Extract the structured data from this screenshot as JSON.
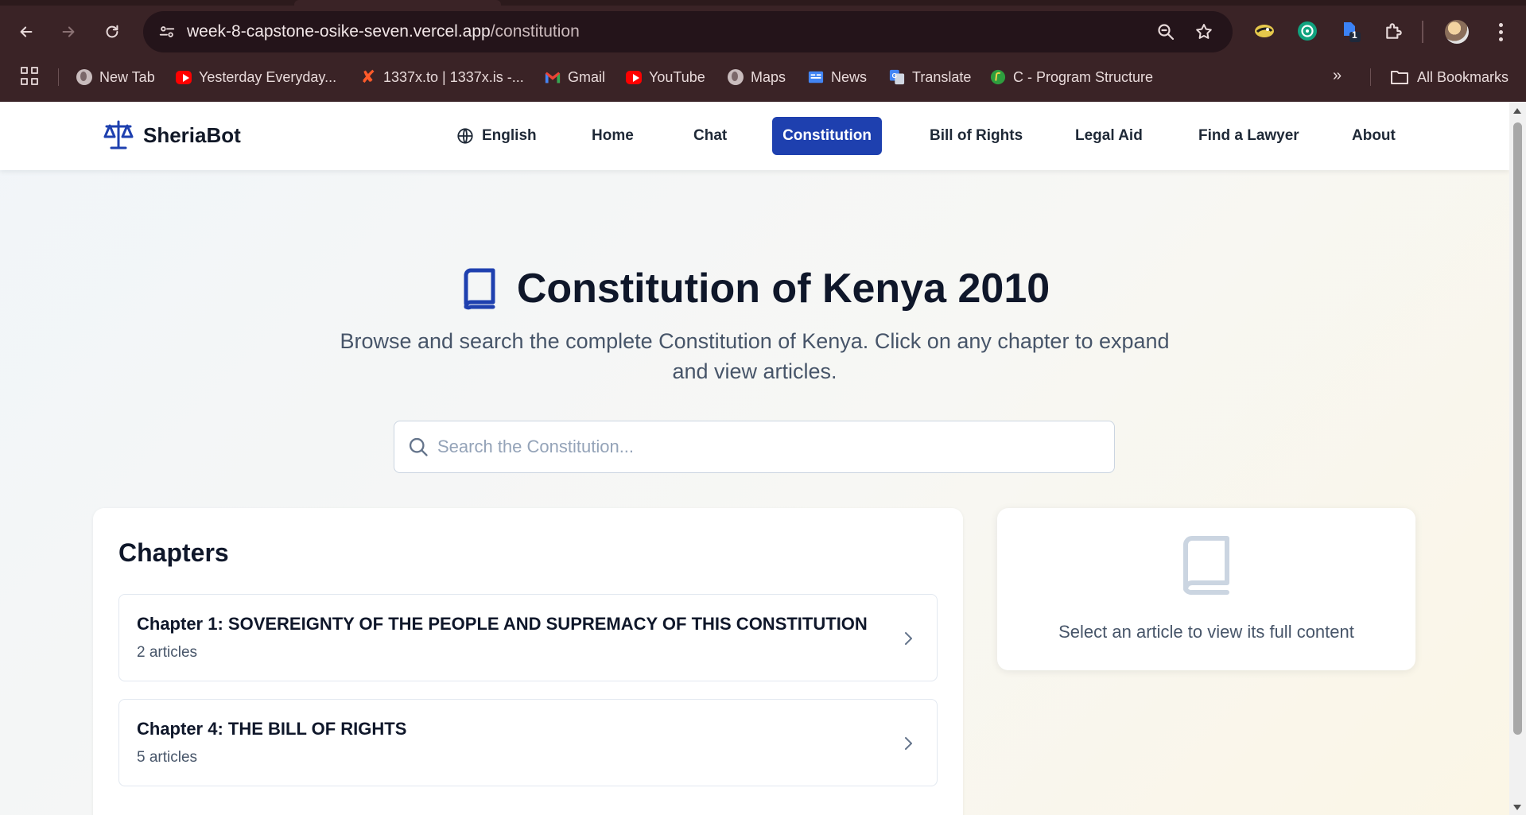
{
  "browser": {
    "url_host": "week-8-capstone-osike-seven.vercel.app",
    "url_path": "/constitution",
    "bookmarks": [
      {
        "label": "New Tab",
        "icon": "globe-icon"
      },
      {
        "label": "Yesterday Everyday...",
        "icon": "youtube-icon"
      },
      {
        "label": "1337x.to | 1337x.is -...",
        "icon": "x-icon"
      },
      {
        "label": "Gmail",
        "icon": "gmail-icon"
      },
      {
        "label": "YouTube",
        "icon": "youtube-icon"
      },
      {
        "label": "Maps",
        "icon": "globe-icon"
      },
      {
        "label": "News",
        "icon": "news-icon"
      },
      {
        "label": "Translate",
        "icon": "translate-icon"
      },
      {
        "label": "C - Program Structure",
        "icon": "c-program-icon"
      }
    ],
    "all_bookmarks_label": "All Bookmarks",
    "extension_badge": "1"
  },
  "header": {
    "brand": "SheriaBot",
    "language": "English",
    "nav": [
      "Home",
      "Chat",
      "Constitution",
      "Bill of Rights",
      "Legal Aid",
      "Find a Lawyer",
      "About"
    ],
    "active": "Constitution"
  },
  "hero": {
    "title": "Constitution of Kenya 2010",
    "subtitle": "Browse and search the complete Constitution of Kenya. Click on any chapter to expand and view articles."
  },
  "search": {
    "placeholder": "Search the Constitution...",
    "value": ""
  },
  "chapters": {
    "heading": "Chapters",
    "items": [
      {
        "title": "Chapter 1: SOVEREIGNTY OF THE PEOPLE AND SUPREMACY OF THIS CONSTITUTION",
        "count": "2 articles"
      },
      {
        "title": "Chapter 4: THE BILL OF RIGHTS",
        "count": "5 articles"
      }
    ]
  },
  "article_panel": {
    "message": "Select an article to view its full content"
  },
  "colors": {
    "primary": "#1e40af",
    "chrome": "#3a2326",
    "text_dark": "#0f172a",
    "text_muted": "#475569"
  }
}
